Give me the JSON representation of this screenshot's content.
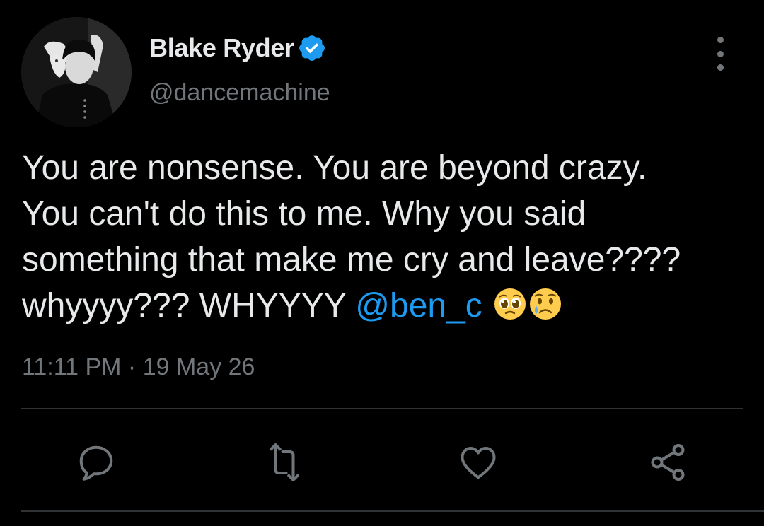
{
  "author": {
    "display_name": "Blake Ryder",
    "handle": "@dancemachine",
    "verified": true,
    "avatar_icon": "profile-photo-grayscale"
  },
  "tweet": {
    "lines": [
      "You are nonsense. You are beyond crazy.",
      "You can't do this to me. Why you said",
      "something that make me cry and leave????",
      "whyyyy??? WHYYYY "
    ],
    "mention": "@ben_c",
    "emojis": [
      "pleading-face-emoji",
      "crying-face-emoji"
    ],
    "timestamp": "11:11 PM · 19 May 26"
  },
  "actions": [
    {
      "name": "reply",
      "icon": "reply-icon"
    },
    {
      "name": "retweet",
      "icon": "retweet-icon"
    },
    {
      "name": "like",
      "icon": "heart-icon"
    },
    {
      "name": "share",
      "icon": "share-icon"
    }
  ],
  "colors": {
    "background": "#000000",
    "text": "#e7e9ea",
    "secondary": "#71767b",
    "accent": "#1d9bf0",
    "divider": "#2f3336"
  }
}
